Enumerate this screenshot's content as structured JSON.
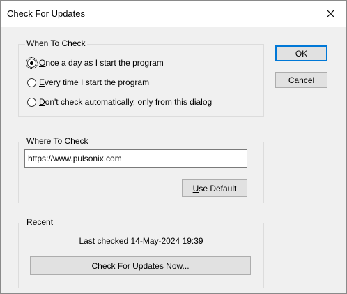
{
  "window": {
    "title": "Check For Updates"
  },
  "when_to_check": {
    "legend": "When To Check",
    "options": [
      {
        "mnemonic": "O",
        "rest": "nce a day as I start the program",
        "checked": true
      },
      {
        "mnemonic": "E",
        "rest": "very time I start the program",
        "checked": false
      },
      {
        "mnemonic": "D",
        "rest": "on't check automatically, only from this dialog",
        "checked": false
      }
    ]
  },
  "where_to_check": {
    "legend_mnemonic": "W",
    "legend_rest": "here To Check",
    "url_value": "https://www.pulsonix.com",
    "use_default_mnemonic": "U",
    "use_default_rest": "se Default"
  },
  "recent": {
    "legend": "Recent",
    "last_checked": "Last checked 14-May-2024 19:39",
    "check_now_mnemonic": "C",
    "check_now_rest": "heck For Updates Now..."
  },
  "buttons": {
    "ok": "OK",
    "cancel": "Cancel"
  },
  "icons": {
    "close": "close-icon"
  }
}
